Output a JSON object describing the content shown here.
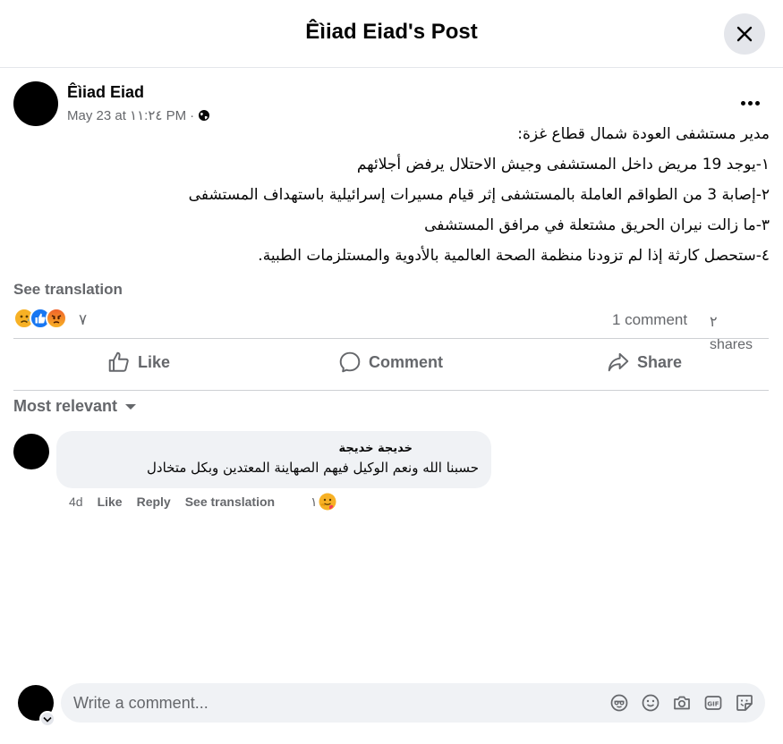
{
  "header": {
    "title": "Êìiad Eiad's Post",
    "close_icon": "close-icon"
  },
  "post": {
    "author": "Êìiad Eiad",
    "timestamp": "May 23 at ١١:٢٤ PM",
    "separator": "·",
    "audience_icon": "globe-icon",
    "more_icon": "more-options-icon",
    "lines": [
      "مدير مستشفى العودة شمال قطاع غزة:",
      "١-يوجد 19 مريض داخل المستشفى وجيش الاحتلال يرفض أجلائهم",
      "٢-إصابة 3 من الطواقم العاملة بالمستشفى إثر قيام مسيرات إسرائيلية باستهداف المستشفى",
      "٣-ما زالت نيران الحريق مشتعلة في مرافق المستشفى",
      "٤-ستحصل كارثة إذا لم تزودنا منظمة الصحة العالمية بالأدوية والمستلزمات الطبية."
    ],
    "see_translation": "See translation"
  },
  "stats": {
    "reactions": [
      "sad",
      "like",
      "angry"
    ],
    "reaction_count": "٧",
    "comments": "1 comment",
    "shares": "٢ shares"
  },
  "actions": {
    "like": "Like",
    "comment": "Comment",
    "share": "Share"
  },
  "sort": {
    "label": "Most relevant"
  },
  "comment": {
    "author": "خديجة خديجة",
    "text": "حسبنا الله ونعم الوكيل فيهم الصهاينة المعتدين وبكل متخادل",
    "age": "4d",
    "like": "Like",
    "reply": "Reply",
    "see_translation": "See translation",
    "reaction": "care",
    "reaction_count": "١"
  },
  "composer": {
    "placeholder": "Write a comment...",
    "icons": [
      "avatar-sticker-icon",
      "emoji-icon",
      "camera-icon",
      "gif-icon",
      "sticker-icon"
    ]
  },
  "colors": {
    "text": "#050505",
    "secondary": "#65676b",
    "bubble": "#f0f2f5",
    "like_blue": "#1877f2"
  }
}
